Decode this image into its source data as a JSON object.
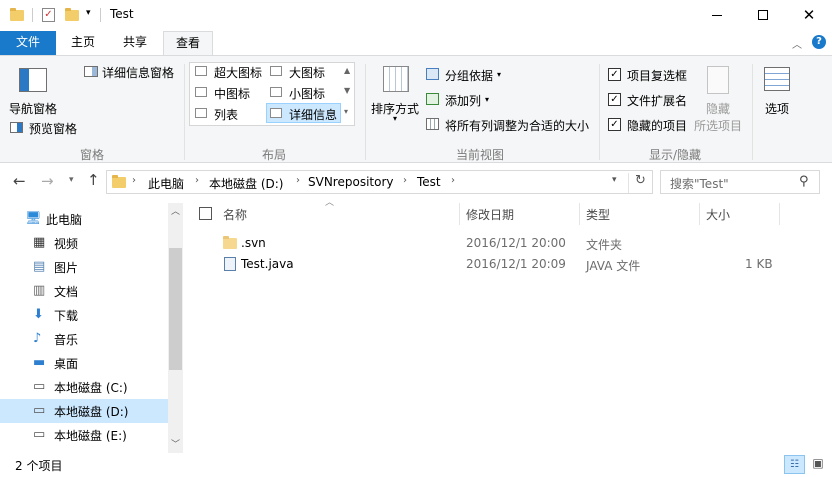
{
  "window": {
    "title": "Test"
  },
  "ribbon_tabs": {
    "file": "文件",
    "home": "主页",
    "share": "共享",
    "view": "查看"
  },
  "panes": {
    "nav_pane": "导航窗格",
    "preview_pane": "预览窗格",
    "details_pane": "详细信息窗格",
    "group": "窗格"
  },
  "layout": {
    "xl_icons": "超大图标",
    "l_icons": "大图标",
    "m_icons": "中图标",
    "s_icons": "小图标",
    "list": "列表",
    "details": "详细信息",
    "group": "布局"
  },
  "current_view": {
    "sort_by": "排序方式",
    "group_by": "分组依据",
    "add_columns": "添加列",
    "size_columns": "将所有列调整为合适的大小",
    "group": "当前视图"
  },
  "show_hide": {
    "item_checkboxes": "项目复选框",
    "extensions": "文件扩展名",
    "hidden_items": "隐藏的项目",
    "hide_selected_1": "隐藏",
    "hide_selected_2": "所选项目",
    "options": "选项",
    "group": "显示/隐藏"
  },
  "address": {
    "crumbs": [
      "此电脑",
      "本地磁盘 (D:)",
      "SVNrepository",
      "Test"
    ],
    "search_placeholder": "搜索\"Test\""
  },
  "nav": [
    {
      "label": "此电脑",
      "icon": "pc-icon"
    },
    {
      "label": "视频",
      "icon": "video-icon"
    },
    {
      "label": "图片",
      "icon": "pictures-icon"
    },
    {
      "label": "文档",
      "icon": "documents-icon"
    },
    {
      "label": "下载",
      "icon": "download-icon"
    },
    {
      "label": "音乐",
      "icon": "music-icon"
    },
    {
      "label": "桌面",
      "icon": "desktop-icon"
    },
    {
      "label": "本地磁盘 (C:)",
      "icon": "drive-icon"
    },
    {
      "label": "本地磁盘 (D:)",
      "icon": "drive-icon",
      "selected": true
    },
    {
      "label": "本地磁盘 (E:)",
      "icon": "drive-icon"
    }
  ],
  "columns": {
    "name": "名称",
    "modified": "修改日期",
    "type": "类型",
    "size": "大小"
  },
  "files": [
    {
      "name": ".svn",
      "modified": "2016/12/1 20:00",
      "type": "文件夹",
      "size": "",
      "icon": "folder-icon"
    },
    {
      "name": "Test.java",
      "modified": "2016/12/1 20:09",
      "type": "JAVA 文件",
      "size": "1 KB",
      "icon": "file-icon"
    }
  ],
  "status": {
    "count": "2 个项目"
  },
  "colors": {
    "accent": "#1979ca",
    "selected": "#cce8ff",
    "ribbon_bg": "#f5f6f7"
  }
}
